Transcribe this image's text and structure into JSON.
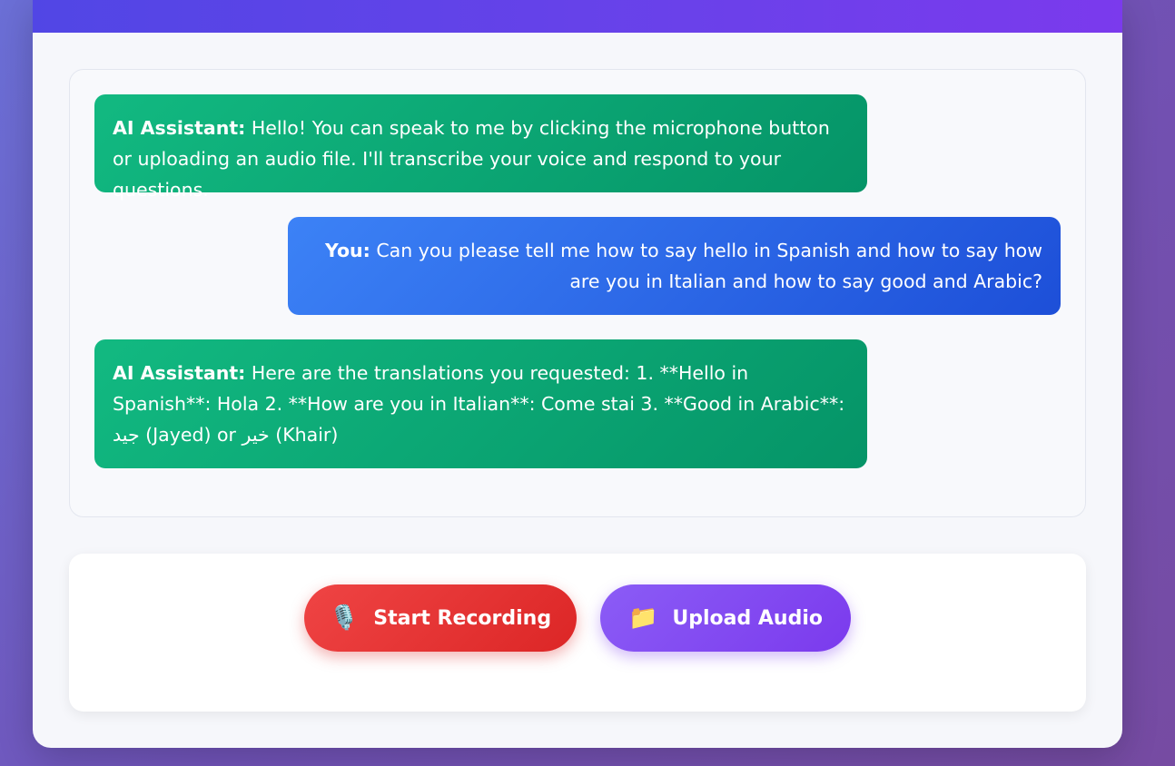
{
  "messages": [
    {
      "role": "assistant",
      "sender": "AI Assistant:",
      "text": "Hello! You can speak to me by clicking the microphone button or uploading an audio file. I'll transcribe your voice and respond to your questions."
    },
    {
      "role": "user",
      "sender": "You:",
      "text": "Can you please tell me how to say hello in Spanish and how to say how are you in Italian and how to say good and Arabic?"
    },
    {
      "role": "assistant",
      "sender": "AI Assistant:",
      "text": "Here are the translations you requested: 1. **Hello in Spanish**: Hola 2. **How are you in Italian**: Come stai 3. **Good in Arabic**: جيد (Jayed) or خير (Khair)"
    }
  ],
  "controls": {
    "record_button": {
      "label": "Start Recording",
      "icon": "microphone-icon",
      "glyph": "🎙️"
    },
    "upload_button": {
      "label": "Upload Audio",
      "icon": "folder-icon",
      "glyph": "📁"
    }
  },
  "colors": {
    "header": "#6a41ea",
    "assistant_bubble": "#10b981",
    "user_bubble": "#3b82f6",
    "record_button": "#ef4444",
    "upload_button": "#8b5cf6"
  }
}
